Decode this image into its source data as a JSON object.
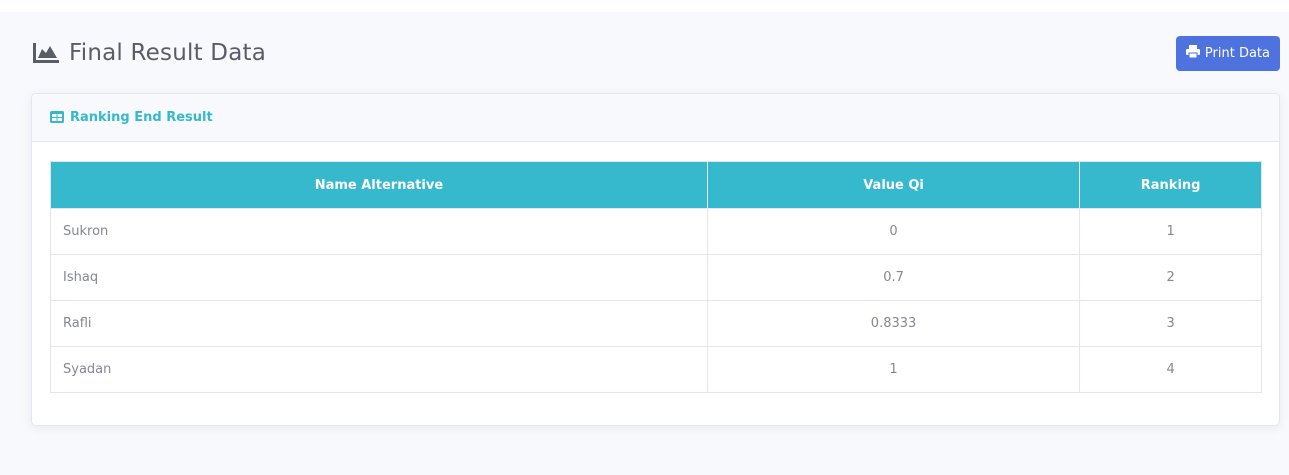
{
  "page": {
    "title": "Final Result Data",
    "title_icon": "area-chart-icon",
    "print_button": {
      "label": "Print Data",
      "icon": "print-icon"
    }
  },
  "card": {
    "title": "Ranking End Result",
    "title_icon": "table-icon"
  },
  "table": {
    "headers": [
      "Name Alternative",
      "Value Qi",
      "Ranking"
    ],
    "rows": [
      {
        "name": "Sukron",
        "value_qi": "0",
        "ranking": "1"
      },
      {
        "name": "Ishaq",
        "value_qi": "0.7",
        "ranking": "2"
      },
      {
        "name": "Rafli",
        "value_qi": "0.8333",
        "ranking": "3"
      },
      {
        "name": "Syadan",
        "value_qi": "1",
        "ranking": "4"
      }
    ]
  },
  "colors": {
    "primary": "#4e73df",
    "info": "#36b9cc",
    "text_muted": "#858796",
    "heading": "#5a5c69"
  }
}
